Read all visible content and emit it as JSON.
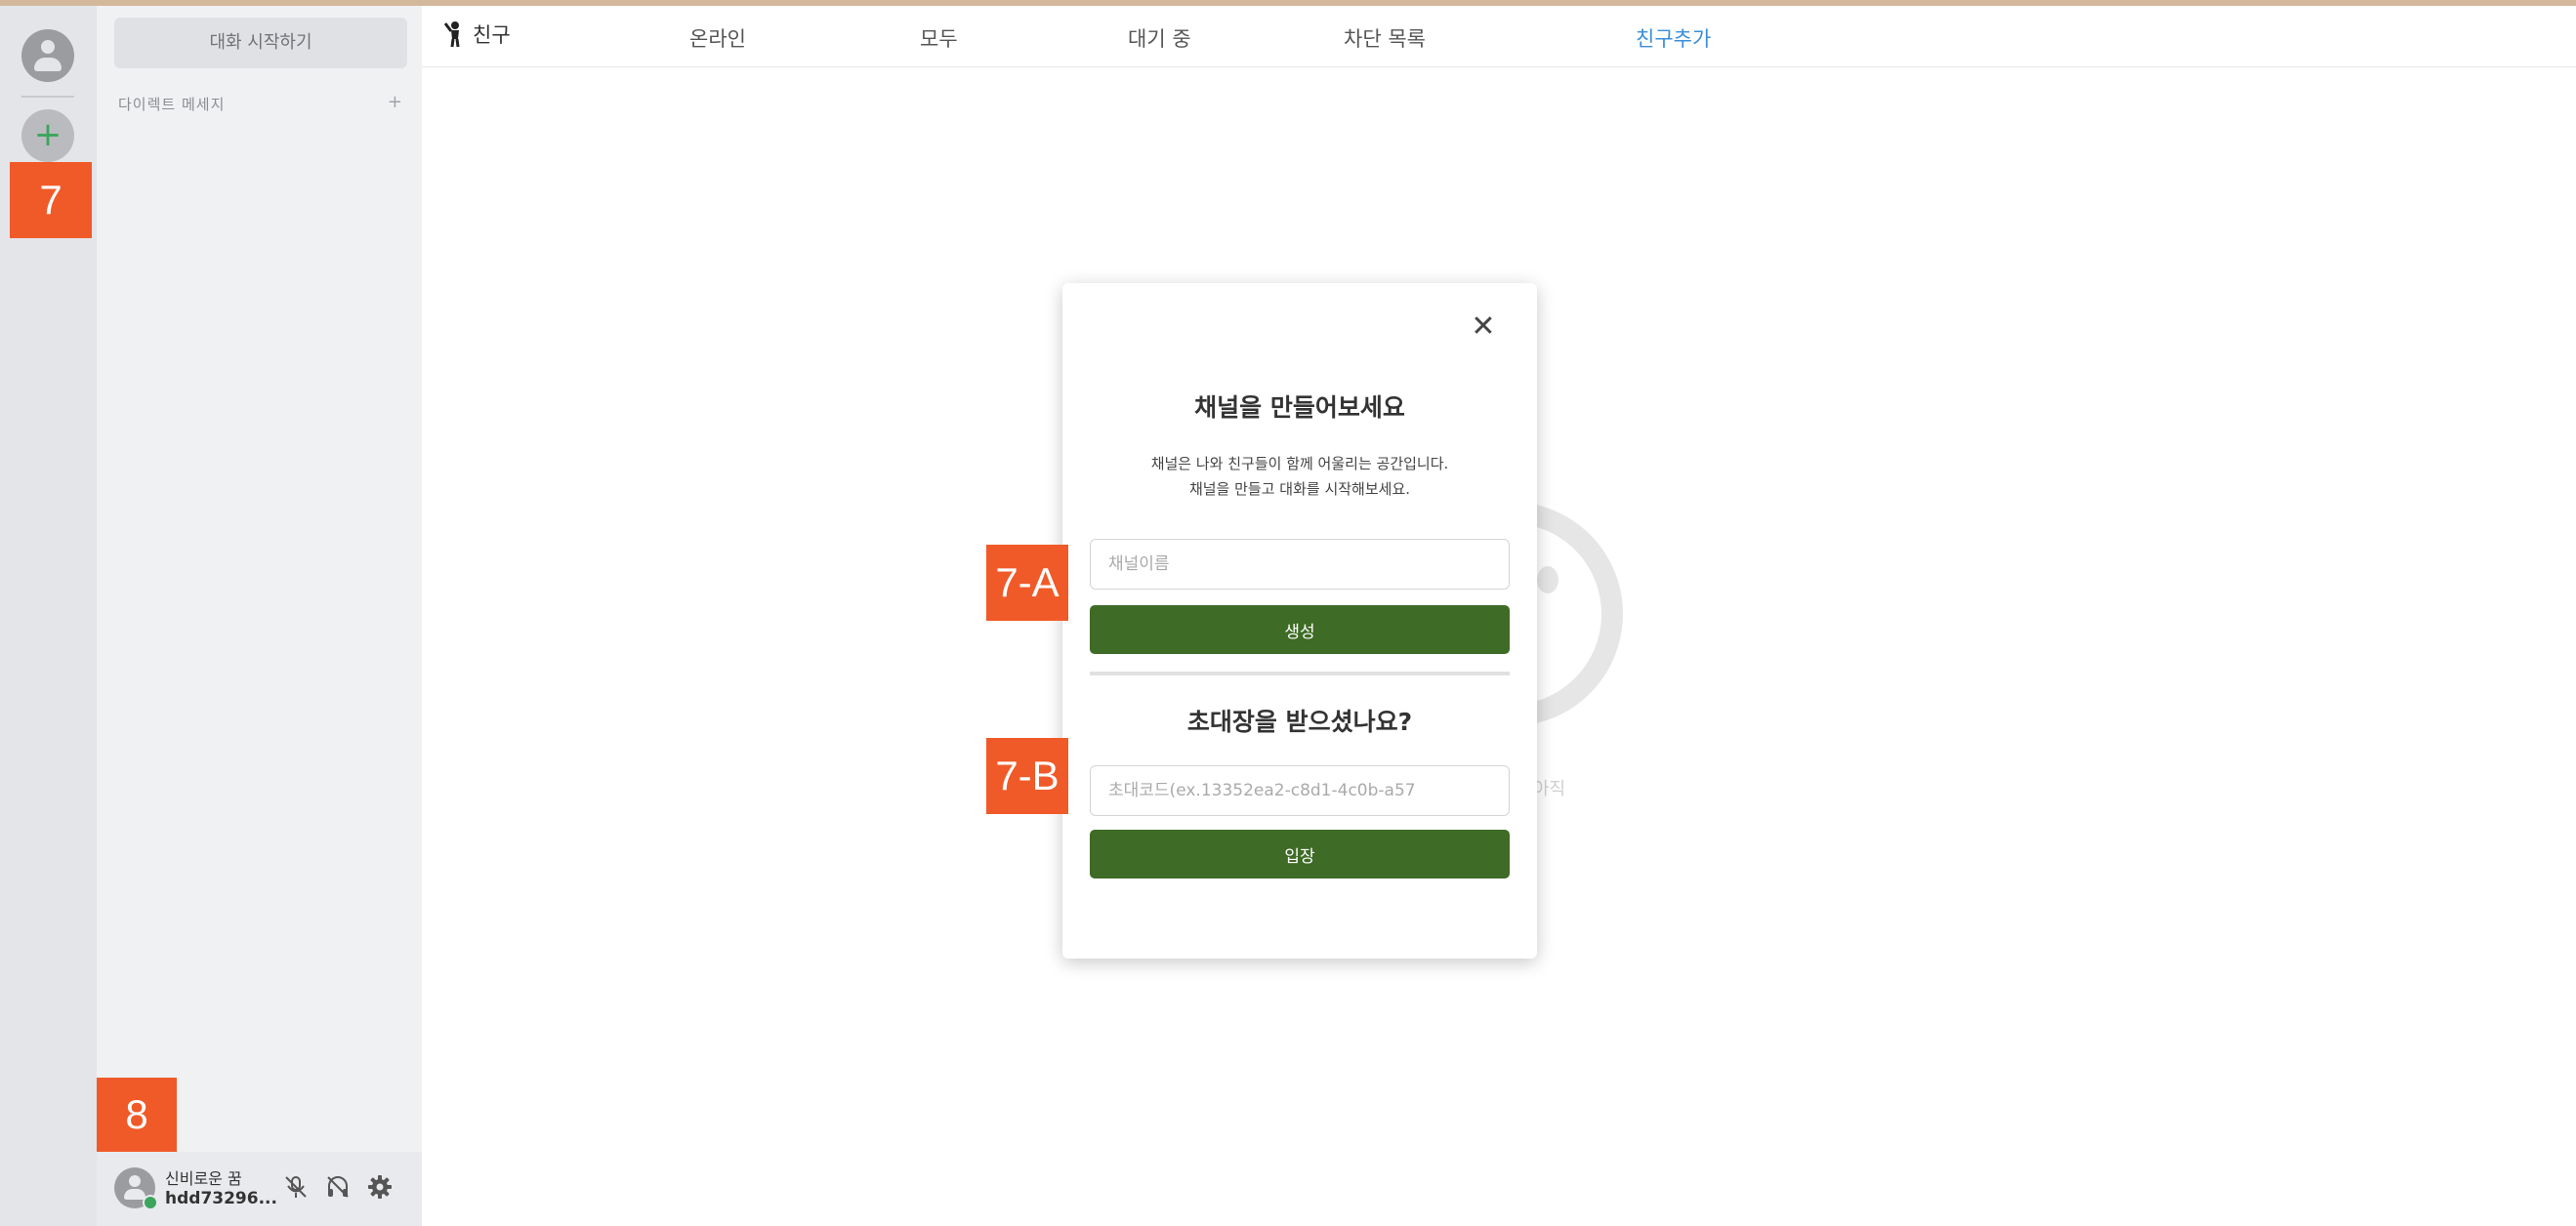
{
  "server_rail": {
    "add_label": "+",
    "tag_label": "7"
  },
  "dm_panel": {
    "start_chat_label": "대화 시작하기",
    "section_title": "다이렉트 메세지",
    "section_add": "+"
  },
  "user_panel": {
    "tag_label": "8",
    "display_name": "신비로운 꿈",
    "user_tag": "hdd73296...",
    "icons": [
      "mic-muted-icon",
      "headset-muted-icon",
      "gear-icon"
    ],
    "status_color": "#3ba55c"
  },
  "top_nav": {
    "friends_label": "친구",
    "tabs": [
      "온라인",
      "모두",
      "대기 중",
      "차단 목록"
    ],
    "add_friend_label": "친구추가"
  },
  "empty_state": {
    "text": "아직"
  },
  "modal": {
    "close_label": "✕",
    "title": "채널을 만들어보세요",
    "description_line1": "채널은 나와 친구들이 함께 어울리는 공간입니다.",
    "description_line2": "채널을 만들고 대화를 시작해보세요.",
    "channel_name_placeholder": "채널이름",
    "create_button": "생성",
    "invite_title": "초대장을 받으셨나요?",
    "invite_placeholder": "초대코드(ex.13352ea2-c8d1-4c0b-a57",
    "join_button": "입장",
    "tag_a": "7-A",
    "tag_b": "7-B",
    "button_color": "#3e6b25"
  }
}
